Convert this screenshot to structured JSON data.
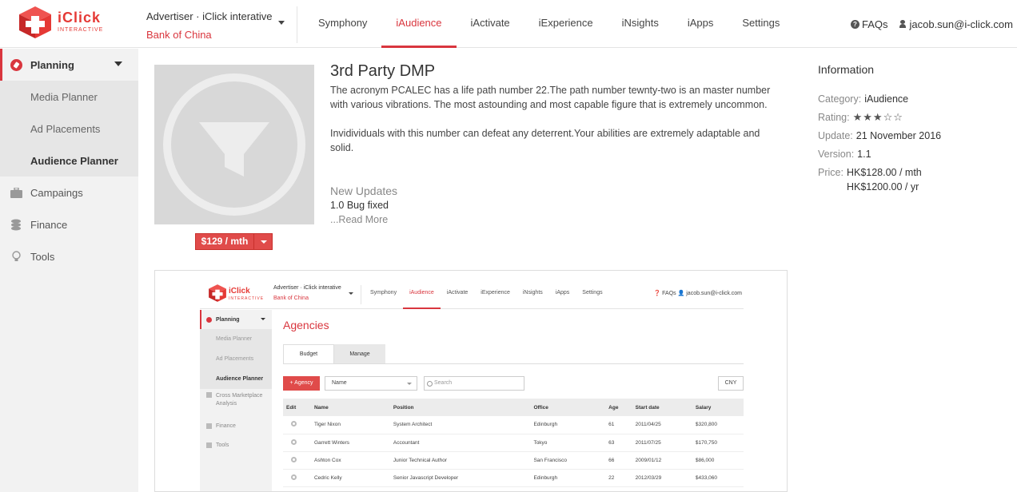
{
  "header": {
    "logo_brand": "iClick",
    "logo_sub": "INTERACTIVE",
    "advertiser_line": "Advertiser · iClick interative",
    "client": "Bank of China",
    "nav": [
      {
        "label": "Symphony"
      },
      {
        "label": "iAudience",
        "active": true
      },
      {
        "label": "iActivate"
      },
      {
        "label": "iExperience"
      },
      {
        "label": "iNsights"
      },
      {
        "label": "iApps"
      },
      {
        "label": "Settings"
      }
    ],
    "faqs": "FAQs",
    "user_email": "jacob.sun@i-click.com"
  },
  "sidebar": {
    "planning": "Planning",
    "planning_items": [
      {
        "label": "Media Planner"
      },
      {
        "label": "Ad Placements"
      },
      {
        "label": "Audience Planner",
        "active": true
      }
    ],
    "campaigns": "Campaings",
    "finance": "Finance",
    "tools": "Tools"
  },
  "product": {
    "title": "3rd Party DMP",
    "desc_p1": "The acronym PCALEC has a life path number 22.The path number tewnty-two is an master number with various vibrations. The most astounding and most capable figure that is extremely uncommon.",
    "desc_p2": "Invidividuals with this number can defeat any deterrent.Your abilities are extremely adaptable and solid.",
    "price_button": "$129 / mth",
    "updates_title": "New Updates",
    "updates_line": "1.0 Bug fixed",
    "read_more": "...Read More"
  },
  "info": {
    "title": "Information",
    "category_label": "Category:",
    "category_value": "iAudience",
    "rating_label": "Rating:",
    "rating_value": 3,
    "rating_max": 5,
    "rating_stars": "★★★☆☆",
    "update_label": "Update:",
    "update_value": "21 November 2016",
    "version_label": "Version:",
    "version_value": "1.1",
    "price_label": "Price:",
    "price_month": "HK$128.00 / mth",
    "price_year": "HK$1200.00 / yr"
  },
  "preview": {
    "logo_brand": "iClick",
    "logo_sub": "INTERACTIVE",
    "advertiser_line": "Advertiser · iClick interative",
    "client": "Bank of China",
    "nav": [
      "Symphony",
      "iAudience",
      "iActivate",
      "iExperience",
      "iNsights",
      "iApps",
      "Settings"
    ],
    "right": "❓ FAQs   👤 jacob.sun@i-click.com",
    "side_planning": "Planning",
    "side_items": [
      "Media Planner",
      "Ad Placements",
      "Audience Planner"
    ],
    "side_cross": "Cross Marketplace Analysis",
    "side_finance": "Finance",
    "side_tools": "Tools",
    "page_title": "Agencies",
    "tab_budget": "Budget",
    "tab_manage": "Manage",
    "add_button": "+ Agency",
    "select_value": "Name",
    "search_placeholder": "Search",
    "currency": "CNY",
    "columns": [
      "Edit",
      "Name",
      "Position",
      "Office",
      "Age",
      "Start date",
      "Salary"
    ],
    "rows": [
      [
        "Tiger Nixon",
        "System Architect",
        "Edinburgh",
        "61",
        "2011/04/25",
        "$320,800"
      ],
      [
        "Garrett Winters",
        "Accountant",
        "Tokyo",
        "63",
        "2011/07/25",
        "$170,750"
      ],
      [
        "Ashton Cox",
        "Junior Technical Author",
        "San Francisco",
        "66",
        "2009/01/12",
        "$86,000"
      ],
      [
        "Cedric Kelly",
        "Senior Javascript Developer",
        "Edinburgh",
        "22",
        "2012/03/29",
        "$433,060"
      ]
    ]
  },
  "colors": {
    "accent": "#d9363e",
    "sidebar_bg": "#f2f2f2",
    "sidebar_sub_bg": "#e6e6e6",
    "thumb_bg": "#d8d8d8"
  }
}
